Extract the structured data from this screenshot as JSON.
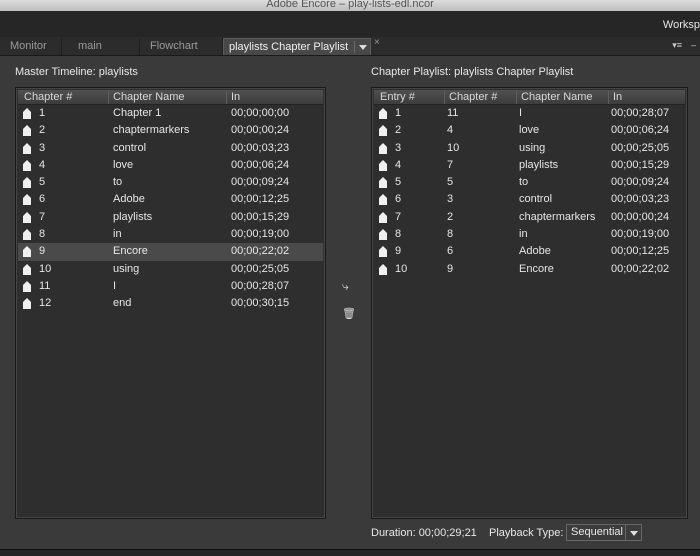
{
  "window": {
    "title": "Adobe Encore – play-lists-edl.ncor"
  },
  "workspace_label": "Worksp",
  "tabs": [
    {
      "label": "Monitor"
    },
    {
      "label": "main"
    },
    {
      "label": "Flowchart"
    },
    {
      "label": "playlists Chapter Playlist"
    }
  ],
  "icons": {
    "panel_menu": "▾≡",
    "minimize": "–",
    "close": "×",
    "move_right": "⤷",
    "delete": "🗑"
  },
  "master": {
    "label": "Master Timeline: playlists",
    "columns": [
      "Chapter #",
      "Chapter Name",
      "In"
    ],
    "selected_index": 8,
    "rows": [
      {
        "num": "1",
        "name": "Chapter 1",
        "in": "00;00;00;00"
      },
      {
        "num": "2",
        "name": "chaptermarkers",
        "in": "00;00;00;24"
      },
      {
        "num": "3",
        "name": "control",
        "in": "00;00;03;23"
      },
      {
        "num": "4",
        "name": "love",
        "in": "00;00;06;24"
      },
      {
        "num": "5",
        "name": "to",
        "in": "00;00;09;24"
      },
      {
        "num": "6",
        "name": "Adobe",
        "in": "00;00;12;25"
      },
      {
        "num": "7",
        "name": "playlists",
        "in": "00;00;15;29"
      },
      {
        "num": "8",
        "name": "in",
        "in": "00;00;19;00"
      },
      {
        "num": "9",
        "name": "Encore",
        "in": "00;00;22;02"
      },
      {
        "num": "10",
        "name": "using",
        "in": "00;00;25;05"
      },
      {
        "num": "11",
        "name": "I",
        "in": "00;00;28;07"
      },
      {
        "num": "12",
        "name": "end",
        "in": "00;00;30;15"
      }
    ]
  },
  "playlist": {
    "label": "Chapter Playlist: playlists Chapter Playlist",
    "columns": [
      "Entry #",
      "Chapter #",
      "Chapter Name",
      "In"
    ],
    "rows": [
      {
        "entry": "1",
        "chapter": "11",
        "name": "I",
        "in": "00;00;28;07"
      },
      {
        "entry": "2",
        "chapter": "4",
        "name": "love",
        "in": "00;00;06;24"
      },
      {
        "entry": "3",
        "chapter": "10",
        "name": "using",
        "in": "00;00;25;05"
      },
      {
        "entry": "4",
        "chapter": "7",
        "name": "playlists",
        "in": "00;00;15;29"
      },
      {
        "entry": "5",
        "chapter": "5",
        "name": "to",
        "in": "00;00;09;24"
      },
      {
        "entry": "6",
        "chapter": "3",
        "name": "control",
        "in": "00;00;03;23"
      },
      {
        "entry": "7",
        "chapter": "2",
        "name": "chaptermarkers",
        "in": "00;00;00;24"
      },
      {
        "entry": "8",
        "chapter": "8",
        "name": "in",
        "in": "00;00;19;00"
      },
      {
        "entry": "9",
        "chapter": "6",
        "name": "Adobe",
        "in": "00;00;12;25"
      },
      {
        "entry": "10",
        "chapter": "9",
        "name": "Encore",
        "in": "00;00;22;02"
      }
    ]
  },
  "footer": {
    "duration": "Duration: 00;00;29;21",
    "playback_label": "Playback Type:",
    "playback_value": "Sequential"
  }
}
